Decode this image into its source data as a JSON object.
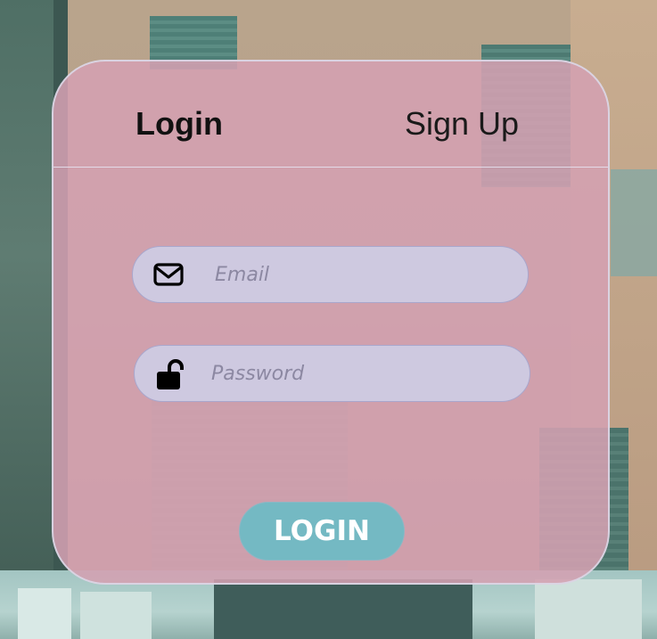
{
  "tabs": {
    "login_label": "Login",
    "signup_label": "Sign Up"
  },
  "form": {
    "email_placeholder": "Email",
    "email_value": "",
    "email_icon": "envelope-icon",
    "password_placeholder": "Password",
    "password_value": "",
    "password_icon": "unlock-icon",
    "submit_label": "LOGIN"
  },
  "colors": {
    "card_background": "#d4a0b2",
    "field_background": "#cec9e0",
    "button_background": "#74b9c3",
    "button_text": "#ffffff"
  }
}
